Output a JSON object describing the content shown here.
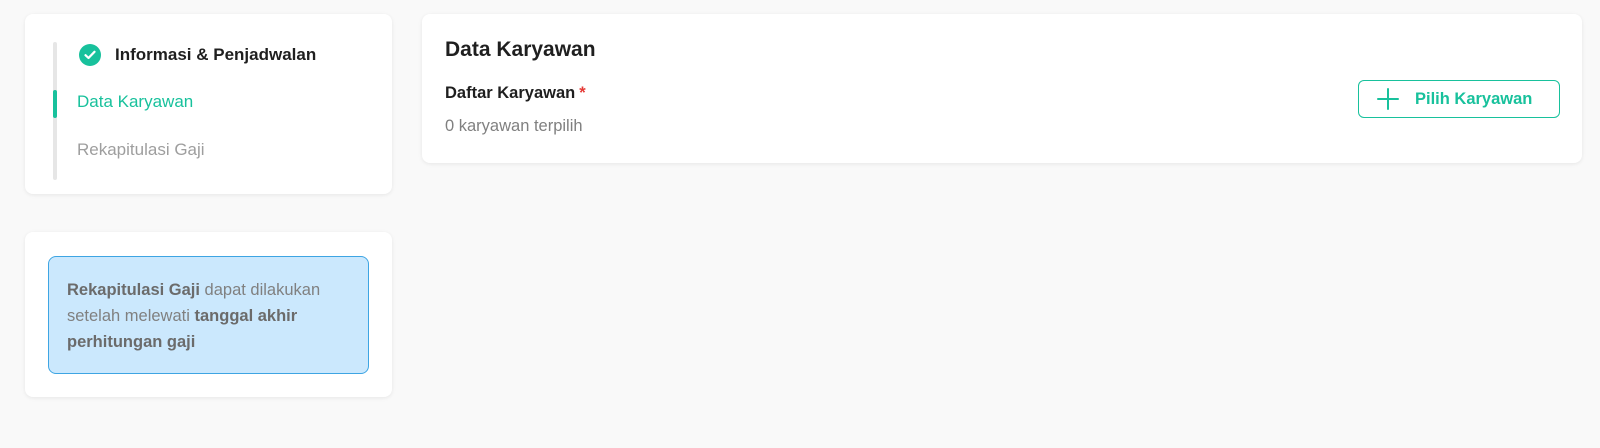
{
  "stepper": {
    "steps": [
      {
        "label": "Informasi & Penjadwalan",
        "status": "done",
        "icon": "check-circle-icon"
      },
      {
        "label": "Data Karyawan",
        "status": "active"
      },
      {
        "label": "Rekapitulasi Gaji",
        "status": "pending"
      }
    ]
  },
  "info": {
    "part1": "Rekapitulasi Gaji",
    "part2": " dapat dilakukan setelah melewati ",
    "part3": "tanggal akhir perhitungan gaji"
  },
  "main": {
    "title": "Data Karyawan",
    "field_label": "Daftar Karyawan",
    "required_mark": "*",
    "selected_text": "0 karyawan terpilih",
    "pick_button_label": "Pilih Karyawan",
    "pick_button_icon": "plus-icon"
  },
  "colors": {
    "accent": "#18c19c",
    "info_bg": "#cbe8fd",
    "info_border": "#3ea5e3",
    "required": "#e53935"
  }
}
